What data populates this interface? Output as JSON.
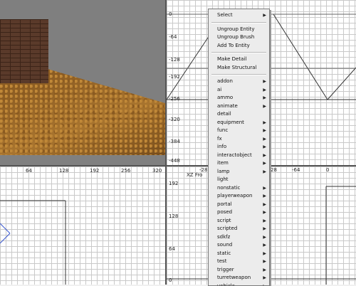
{
  "views": {
    "top_right": {
      "y_ticks": [
        "0",
        "-64",
        "-128",
        "-192",
        "-256",
        "-320",
        "-384",
        "-448"
      ]
    },
    "bottom_left": {
      "x_ticks": [
        "64",
        "128",
        "192",
        "256",
        "320"
      ]
    },
    "bottom_right": {
      "label": "XZ Fro",
      "x_ticks": [
        "-28",
        "28",
        "-64",
        "0"
      ],
      "y_ticks": [
        "192",
        "128",
        "64",
        "0"
      ]
    }
  },
  "context_menu": {
    "items_top": [
      {
        "label": "Select",
        "submenu": true
      }
    ],
    "items_group": [
      {
        "label": "Ungroup Entity"
      },
      {
        "label": "Ungroup Brush"
      },
      {
        "label": "Add To Entity"
      }
    ],
    "items_detail": [
      {
        "label": "Make Detail"
      },
      {
        "label": "Make Structural"
      }
    ],
    "entities": [
      {
        "label": "addon",
        "submenu": true
      },
      {
        "label": "ai",
        "submenu": true
      },
      {
        "label": "ammo",
        "submenu": true
      },
      {
        "label": "animate",
        "submenu": true
      },
      {
        "label": "detail",
        "submenu": false
      },
      {
        "label": "equipment",
        "submenu": true
      },
      {
        "label": "func",
        "submenu": true
      },
      {
        "label": "fx",
        "submenu": true
      },
      {
        "label": "info",
        "submenu": true
      },
      {
        "label": "interactobject",
        "submenu": true
      },
      {
        "label": "item",
        "submenu": true
      },
      {
        "label": "lamp",
        "submenu": true
      },
      {
        "label": "light",
        "submenu": false
      },
      {
        "label": "nonstatic",
        "submenu": true
      },
      {
        "label": "playerweapon",
        "submenu": true
      },
      {
        "label": "portal",
        "submenu": true
      },
      {
        "label": "posed",
        "submenu": true
      },
      {
        "label": "script",
        "submenu": true
      },
      {
        "label": "scripted",
        "submenu": true
      },
      {
        "label": "sdkfz",
        "submenu": true
      },
      {
        "label": "sound",
        "submenu": true
      },
      {
        "label": "static",
        "submenu": true
      },
      {
        "label": "test",
        "submenu": true
      },
      {
        "label": "trigger",
        "submenu": true
      },
      {
        "label": "turretweapon",
        "submenu": true
      },
      {
        "label": "vehicle",
        "submenu": true
      }
    ]
  }
}
